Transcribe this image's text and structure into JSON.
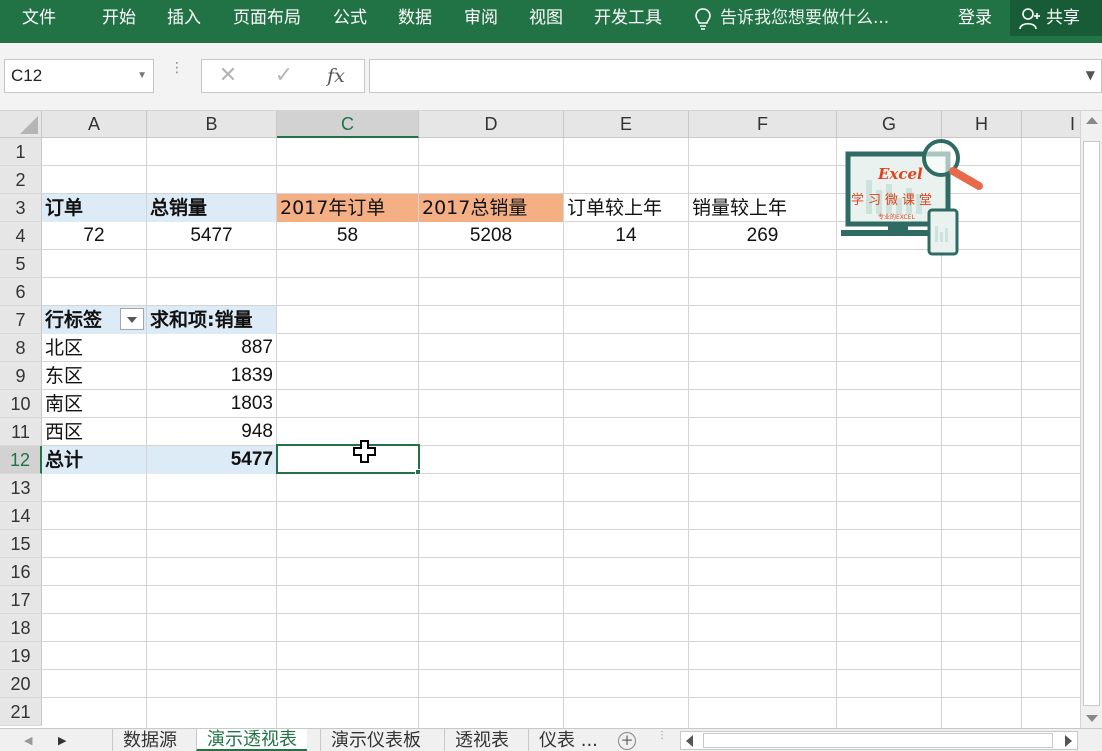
{
  "ribbon": {
    "tabs": [
      "文件",
      "开始",
      "插入",
      "页面布局",
      "公式",
      "数据",
      "审阅",
      "视图",
      "开发工具"
    ],
    "tell_me": "告诉我您想要做什么...",
    "login": "登录",
    "share": "共享",
    "colors": {
      "ribbon_bg": "#217346",
      "share_bg": "#185c37"
    }
  },
  "formula_bar": {
    "name_box": "C12",
    "cancel_icon": "✕",
    "enter_icon": "✓",
    "fx_label": "fx",
    "formula": ""
  },
  "columns": [
    "A",
    "B",
    "C",
    "D",
    "E",
    "F",
    "G",
    "H",
    "I"
  ],
  "selected_column": "C",
  "rows": [
    "1",
    "2",
    "3",
    "4",
    "5",
    "6",
    "7",
    "8",
    "9",
    "10",
    "11",
    "12",
    "13",
    "14",
    "15",
    "16",
    "17",
    "18",
    "19",
    "20",
    "21"
  ],
  "selected_row": "12",
  "cells": {
    "A3": "订单",
    "B3": "总销量",
    "C3": "2017年订单",
    "D3": "2017总销量",
    "E3": "订单较上年",
    "F3": "销量较上年",
    "A4": "72",
    "B4": "5477",
    "C4": "58",
    "D4": "5208",
    "E4": "14",
    "F4": "269",
    "A7": "行标签",
    "B7": "求和项:销量",
    "A8": "北区",
    "B8": "887",
    "A9": "东区",
    "B9": "1839",
    "A10": "南区",
    "B10": "1803",
    "A11": "西区",
    "B11": "948",
    "A12": "总计",
    "B12": "5477"
  },
  "logo": {
    "title": "Excel",
    "subtitle": "学习微课堂",
    "small": "专业的EXCEL"
  },
  "sheet_tabs": [
    "数据源",
    "演示透视表",
    "演示仪表板",
    "透视表",
    "仪表 ..."
  ],
  "active_sheet": "演示透视表",
  "accent_colors": {
    "pivot_header": "#ddebf7",
    "highlight": "#f4b084",
    "selection": "#217346"
  }
}
